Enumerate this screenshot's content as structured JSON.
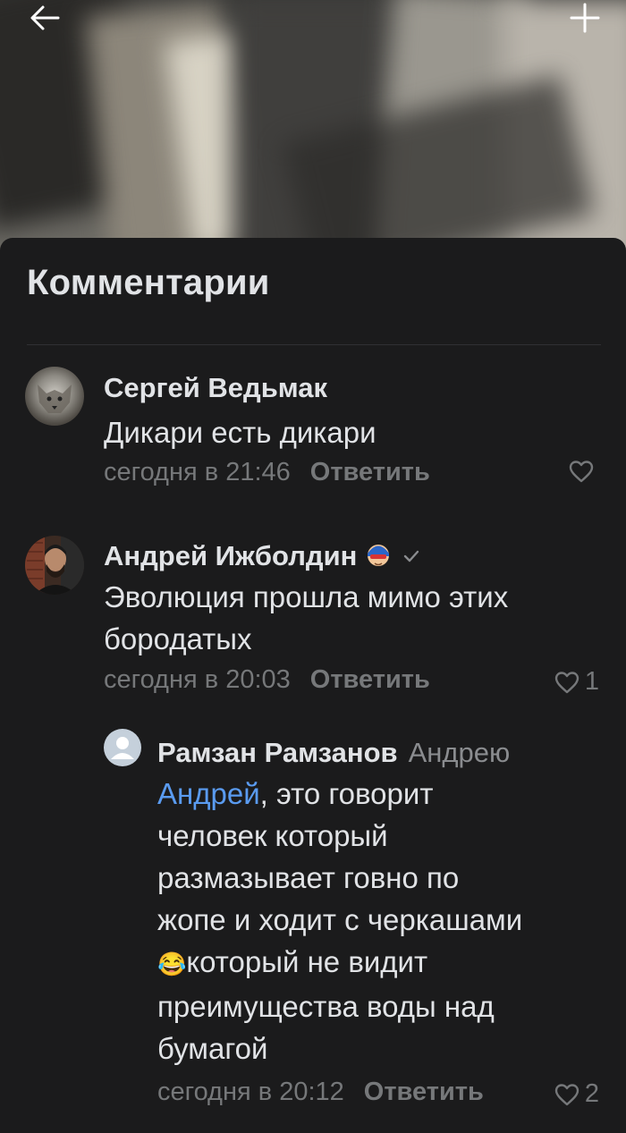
{
  "header": {
    "back_icon": "arrow-left-icon",
    "add_icon": "plus-icon"
  },
  "sheet": {
    "title": "Комментарии"
  },
  "comments": [
    {
      "author": "Сергей Ведьмак",
      "avatar": "wolf-avatar",
      "text": "Дикари есть дикари",
      "time": "сегодня в 21:46",
      "reply_label": "Ответить",
      "likes": ""
    },
    {
      "author": "Андрей Ижболдин",
      "avatar": "person-avatar",
      "badge_icons": [
        "hero-mask-icon",
        "verified-check-icon"
      ],
      "text_line1": "Эволюция прошла мимо этих",
      "text_line2": "бородатых",
      "time": "сегодня в 20:03",
      "reply_label": "Ответить",
      "likes": "1"
    },
    {
      "author": "Рамзан Рамзанов",
      "reply_to": "Андрею",
      "avatar": "default-avatar",
      "mention": "Андрей",
      "text_line1_rest": ", это говорит",
      "text_line2": "человек который",
      "text_line3": "размазывает говно по",
      "text_line4": "жопе и ходит с черкашами",
      "emoji": "😂",
      "text_line5_rest": "который не видит",
      "text_line6": "преимущества воды над",
      "text_line7": "бумагой",
      "time": "сегодня в 20:12",
      "reply_label": "Ответить",
      "likes": "2"
    }
  ],
  "colors": {
    "background": "#1b1b1c",
    "text": "#e1e3e6",
    "secondary": "#76787a",
    "link": "#5a9bf0"
  }
}
